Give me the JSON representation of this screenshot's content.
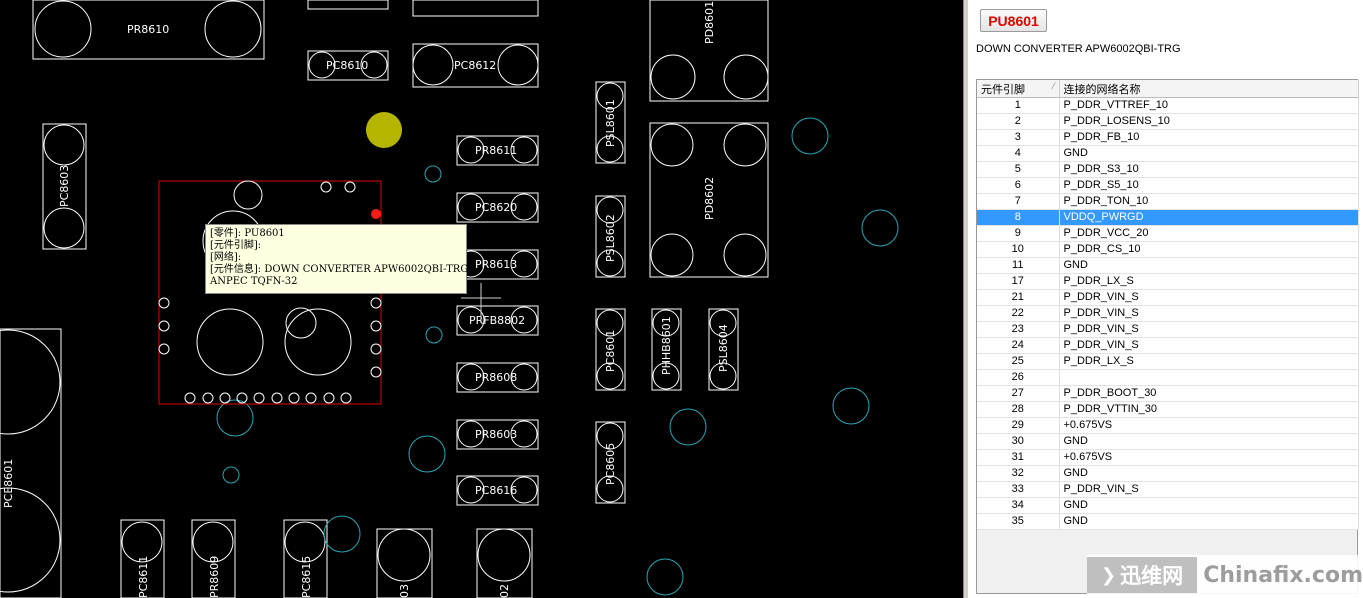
{
  "canvas": {
    "component_labels": [
      "PR8610",
      "PC8610",
      "PC8612",
      "PD8601",
      "PC8603",
      "PR8611",
      "PC8620",
      "PR8613",
      "PRFB8802",
      "PR8608",
      "PR8603",
      "PC8616",
      "PSL8601",
      "PSL8602",
      "PC8601",
      "PC8605",
      "PHHB8601",
      "PSL8604",
      "PD8602",
      "PCE8601",
      "PC8611",
      "PR8609",
      "PC8615",
      "03",
      "02"
    ],
    "colors": {
      "background": "#000000",
      "outline": "#ffffff",
      "selection": "#e00000",
      "via": "#2aa5b5",
      "highlight_pad": "#b5b500"
    }
  },
  "tooltip": {
    "lines": [
      "[零件]: PU8601",
      "[元件引脚]:",
      "[网络]:",
      "[元件信息]: DOWN CONVERTER APW6002QBI-TRG",
      "ANPEC TQFN-32"
    ]
  },
  "panel": {
    "part_button": "PU8601",
    "description": "DOWN CONVERTER APW6002QBI-TRG",
    "table": {
      "headers": [
        "元件引脚",
        "连接的网络名称"
      ],
      "rows": [
        [
          "1",
          "P_DDR_VTTREF_10"
        ],
        [
          "2",
          "P_DDR_LOSENS_10"
        ],
        [
          "3",
          "P_DDR_FB_10"
        ],
        [
          "4",
          "GND"
        ],
        [
          "5",
          "P_DDR_S3_10"
        ],
        [
          "6",
          "P_DDR_S5_10"
        ],
        [
          "7",
          "P_DDR_TON_10"
        ],
        [
          "8",
          "VDDQ_PWRGD"
        ],
        [
          "9",
          "P_DDR_VCC_20"
        ],
        [
          "10",
          "P_DDR_CS_10"
        ],
        [
          "11",
          "GND"
        ],
        [
          "17",
          "P_DDR_LX_S"
        ],
        [
          "21",
          "P_DDR_VIN_S"
        ],
        [
          "22",
          "P_DDR_VIN_S"
        ],
        [
          "23",
          "P_DDR_VIN_S"
        ],
        [
          "24",
          "P_DDR_VIN_S"
        ],
        [
          "25",
          "P_DDR_LX_S"
        ],
        [
          "26",
          ""
        ],
        [
          "27",
          "P_DDR_BOOT_30"
        ],
        [
          "28",
          "P_DDR_VTTIN_30"
        ],
        [
          "29",
          "+0.675VS"
        ],
        [
          "30",
          "GND"
        ],
        [
          "31",
          "+0.675VS"
        ],
        [
          "32",
          "GND"
        ],
        [
          "33",
          "P_DDR_VIN_S"
        ],
        [
          "34",
          "GND"
        ],
        [
          "35",
          "GND"
        ]
      ],
      "selected_pin": "8"
    }
  },
  "watermark": {
    "logo_text": "迅维网",
    "site_text": "Chinafix.com"
  }
}
